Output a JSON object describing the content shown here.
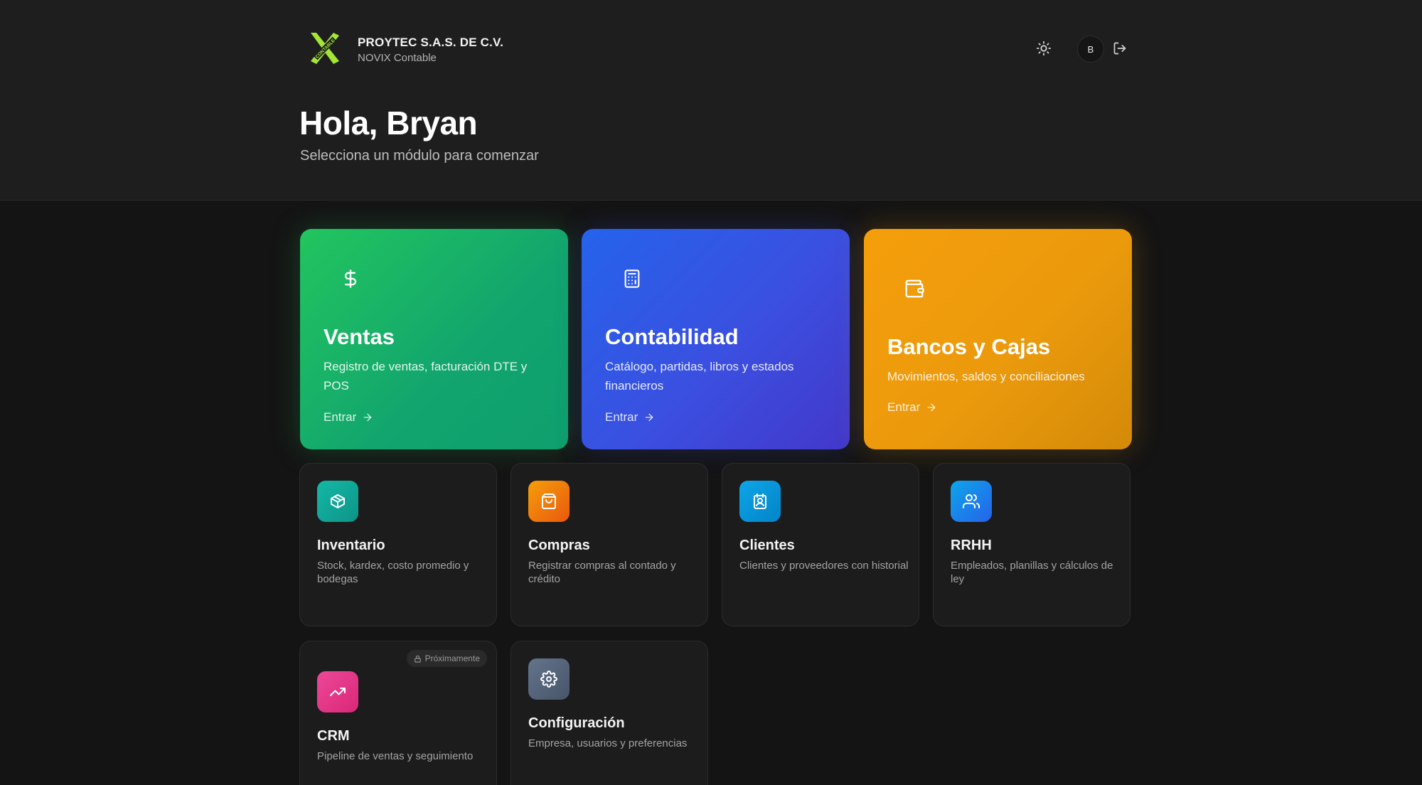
{
  "header": {
    "company_name": "PROYTEC S.A.S. DE C.V.",
    "app_name": "NOVIX Contable",
    "logo_text": "CONTABLE",
    "avatar_initial": "B"
  },
  "greeting": {
    "title": "Hola, Bryan",
    "subtitle": "Selecciona un módulo para comenzar"
  },
  "featured_modules": [
    {
      "title": "Ventas",
      "description": "Registro de ventas, facturación DTE y POS",
      "action": "Entrar",
      "icon": "dollar-icon",
      "color": "#22c55e"
    },
    {
      "title": "Contabilidad",
      "description": "Catálogo, partidas, libros y estados financieros",
      "action": "Entrar",
      "icon": "calculator-icon",
      "color": "#2563eb"
    },
    {
      "title": "Bancos y Cajas",
      "description": "Movimientos, saldos y conciliaciones",
      "action": "Entrar",
      "icon": "wallet-icon",
      "color": "#f59e0b"
    }
  ],
  "modules": [
    {
      "title": "Inventario",
      "description": "Stock, kardex, costo promedio y bodegas",
      "icon": "package-icon",
      "color": "#14b8a6"
    },
    {
      "title": "Compras",
      "description": "Registrar compras al contado y crédito",
      "icon": "shopping-bag-icon",
      "color": "#f97316"
    },
    {
      "title": "Clientes",
      "description": "Clientes y proveedores con historial",
      "icon": "contact-icon",
      "color": "#0ea5e9"
    },
    {
      "title": "RRHH",
      "description": "Empleados, planillas y cálculos de ley",
      "icon": "users-icon",
      "color": "#0ea5e9"
    },
    {
      "title": "CRM",
      "description": "Pipeline de ventas y seguimiento",
      "icon": "trending-up-icon",
      "color": "#ec4899",
      "badge": "Próximamente"
    },
    {
      "title": "Configuración",
      "description": "Empresa, usuarios y preferencias",
      "icon": "gear-icon",
      "color": "#64748b"
    }
  ]
}
